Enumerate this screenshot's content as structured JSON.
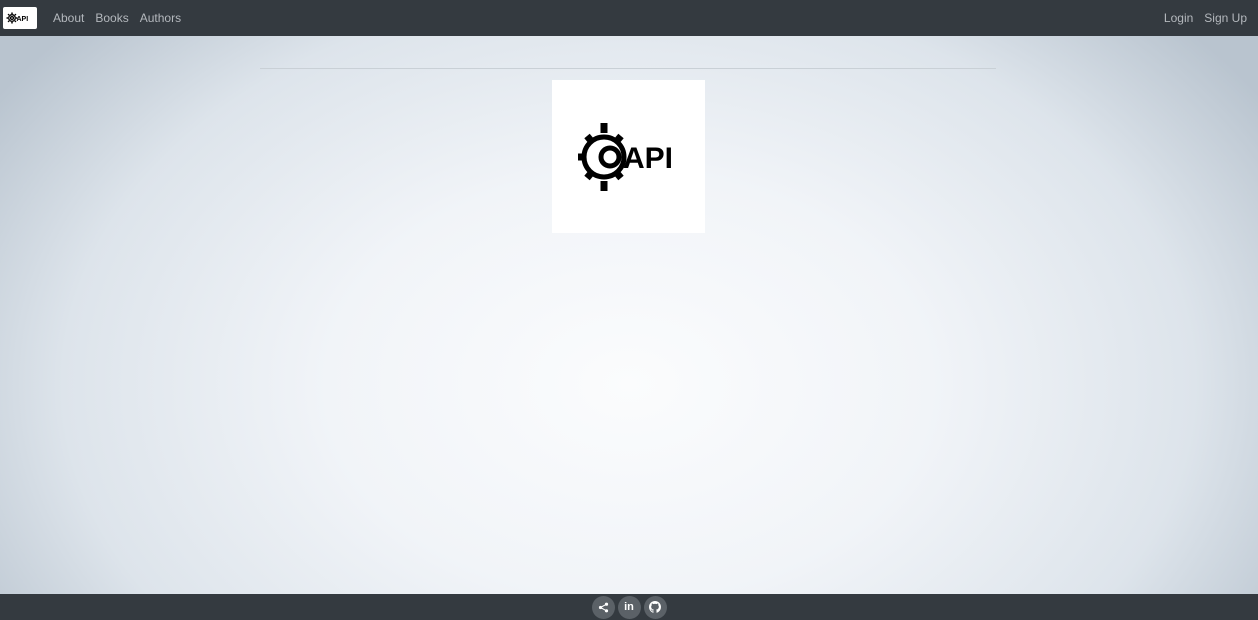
{
  "brand": {
    "logo_text": "API",
    "logo_icon": "gear-icon"
  },
  "nav": {
    "left": [
      "About",
      "Books",
      "Authors"
    ],
    "right": [
      "Login",
      "Sign Up"
    ]
  },
  "hero": {
    "logo_text": "API",
    "logo_icon": "gear-icon"
  },
  "footer": {
    "icons": [
      "share-icon",
      "linkedin-icon",
      "github-icon"
    ],
    "linkedin_label": "in"
  },
  "colors": {
    "navbar": "#343a40",
    "nav_link": "#b4b8bd",
    "social_bg": "#5b6167"
  }
}
